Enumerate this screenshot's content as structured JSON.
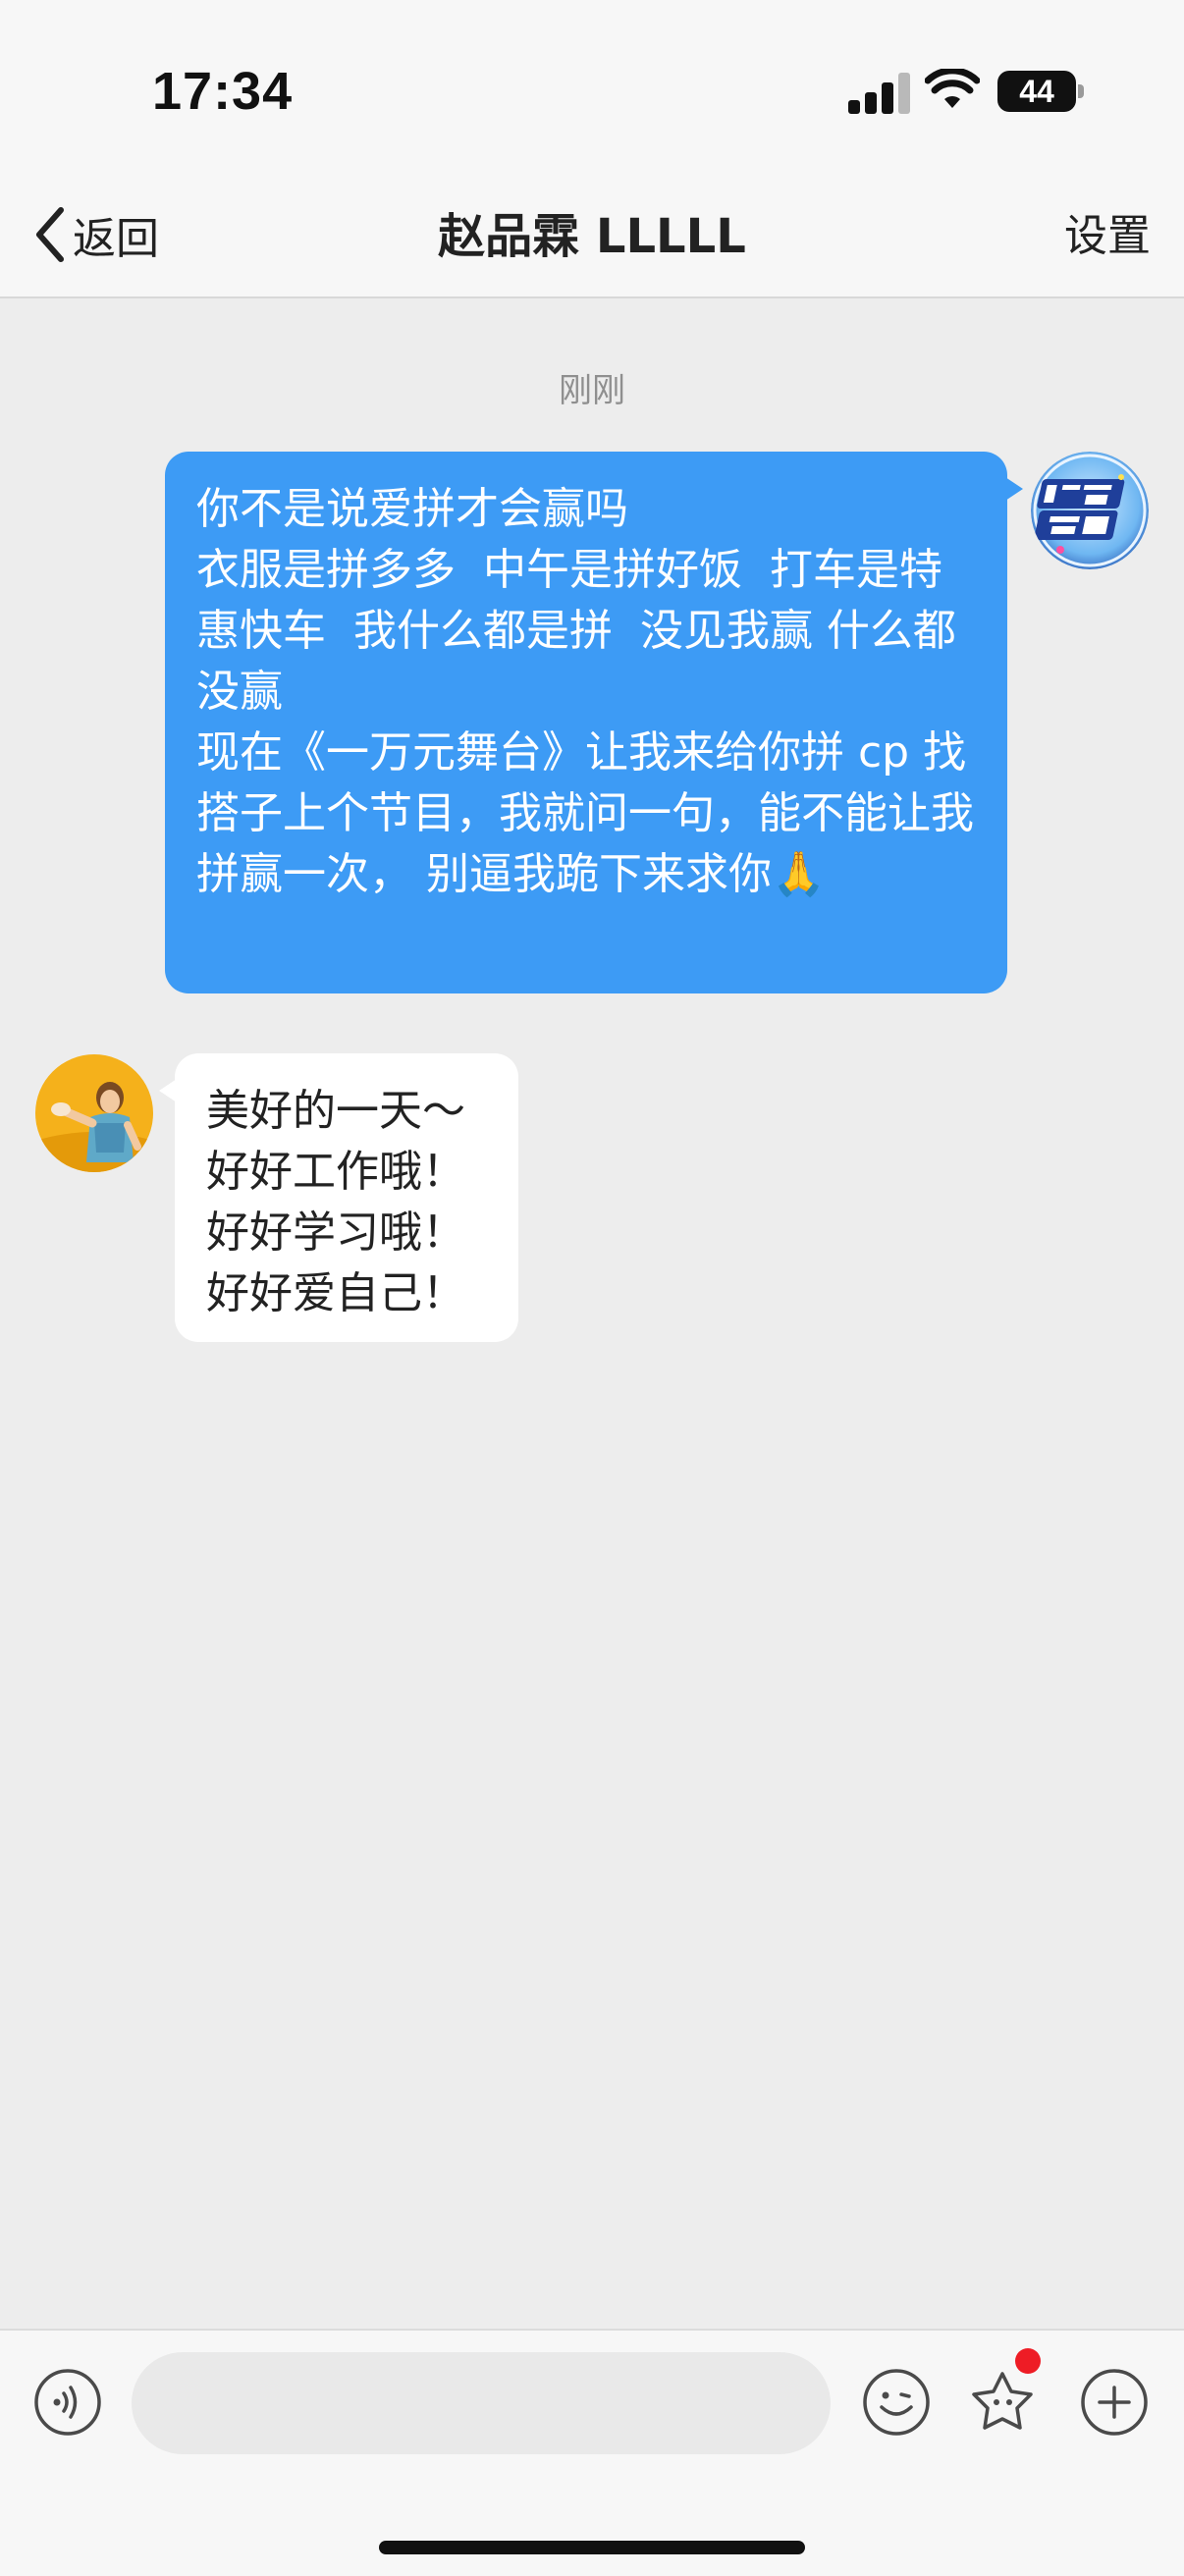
{
  "status_bar": {
    "time": "17:34",
    "battery": "44"
  },
  "nav": {
    "back_label": "返回",
    "title": "赵品霖 LLLLL",
    "settings_label": "设置"
  },
  "chat": {
    "timestamp": "刚刚",
    "messages": [
      {
        "direction": "sent",
        "sender_avatar": "一万元舞台",
        "text": "你不是说爱拼才会赢吗\n衣服是拼多多  中午是拼好饭  打车是特惠快车  我什么都是拼  没见我赢 什么都没赢\n现在《一万元舞台》让我来给你拼 cp 找搭子上个节目，我就问一句，能不能让我拼赢一次， 别逼我跪下来求你🙏"
      },
      {
        "direction": "received",
        "text": "美好的一天～\n好好工作哦！\n好好学习哦！\n好好爱自己！"
      }
    ]
  },
  "input_bar": {
    "message_value": "",
    "message_placeholder": "",
    "icons": [
      "voice-icon",
      "emoji-icon",
      "sticker-icon",
      "plus-icon"
    ],
    "sticker_badge_color": "#ee1c25"
  },
  "colors": {
    "sent_bubble": "#3d9bf5",
    "received_bubble": "#ffffff",
    "chat_background": "#ededed"
  }
}
